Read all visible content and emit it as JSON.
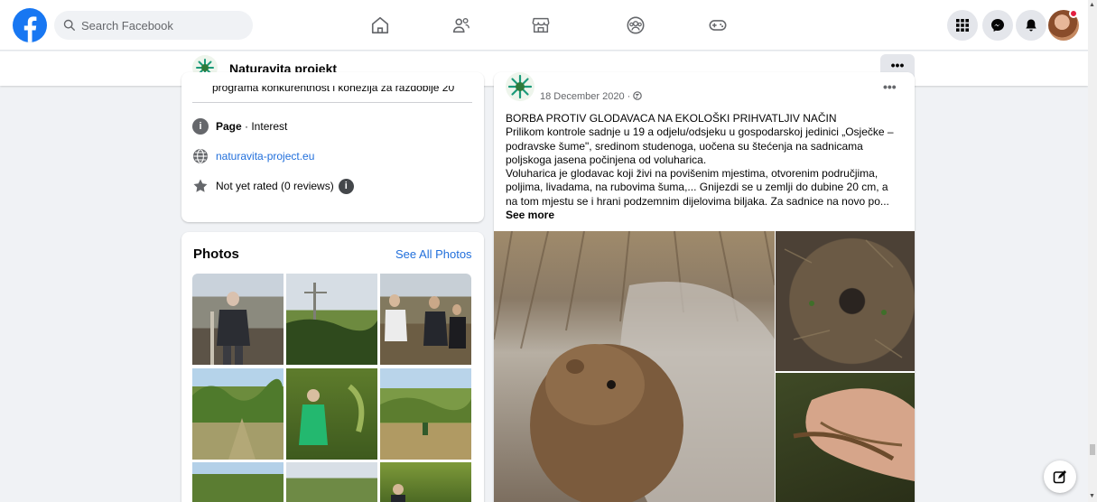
{
  "search": {
    "placeholder": "Search Facebook"
  },
  "nav": {
    "icons": [
      "home-icon",
      "friends-icon",
      "marketplace-icon",
      "groups-icon",
      "gaming-icon"
    ]
  },
  "header_right": {
    "icons": [
      "menu-grid-icon",
      "messenger-icon",
      "bell-icon"
    ]
  },
  "page": {
    "name": "Naturavita projekt",
    "more_label": "•••"
  },
  "about": {
    "clipped_text": "programa konkurentnost i kohezija za razdoblje 20",
    "category_bold": "Page",
    "category_rest": " · Interest",
    "website": "naturavita-project.eu",
    "rating": "Not yet rated (0 reviews)"
  },
  "photos": {
    "title": "Photos",
    "see_all": "See All Photos"
  },
  "post": {
    "date": "18 December 2020 ·",
    "dots": "•••",
    "lines": [
      "BORBA PROTIV GLODAVACA NA EKOLOŠKI PRIHVATLJIV NAČIN",
      "Prilikom kontrole sadnje u 19 a odjelu/odsjeku u gospodarskoj jedinici „Osječke – podravske šume\", sredinom studenoga, uočena su štećenja na sadnicama poljskoga jasena počinjena od voluharica.",
      "Voluharica je glodavac koji živi na povišenim mjestima, otvorenim područjima, poljima, livadama, na rubovima šuma,... Gnijezdi se u zemlji do dubine 20 cm, a na tom mjestu se i hrani podzemnim dijelovima biljaka. Za sadnice na novo po..."
    ],
    "see_more": "See more"
  },
  "colors": {
    "brand": "#1877f2",
    "link": "#216fdb",
    "background": "#f0f2f5",
    "notification": "#e41e3f"
  }
}
